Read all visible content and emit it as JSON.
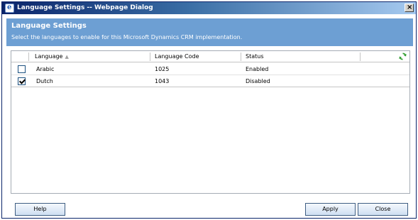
{
  "window": {
    "title": "Language Settings -- Webpage Dialog",
    "icon": "ie-icon",
    "close_label": "×"
  },
  "header": {
    "title": "Language Settings",
    "subtitle": "Select the languages to enable for this Microsoft Dynamics CRM implementation."
  },
  "grid": {
    "columns": [
      "Language",
      "Language Code",
      "Status"
    ],
    "sort_column": "Language",
    "sort_direction": "ascending",
    "rows": [
      {
        "checked": false,
        "language": "Arabic",
        "code": "1025",
        "status": "Enabled"
      },
      {
        "checked": true,
        "language": "Dutch",
        "code": "1043",
        "status": "Disabled"
      }
    ]
  },
  "buttons": {
    "help": "Help",
    "apply": "Apply",
    "close": "Close"
  },
  "colors": {
    "header_bg": "#6d9fd3",
    "titlebar_start": "#0a246a",
    "refresh_icon": "#2e9d2e"
  }
}
